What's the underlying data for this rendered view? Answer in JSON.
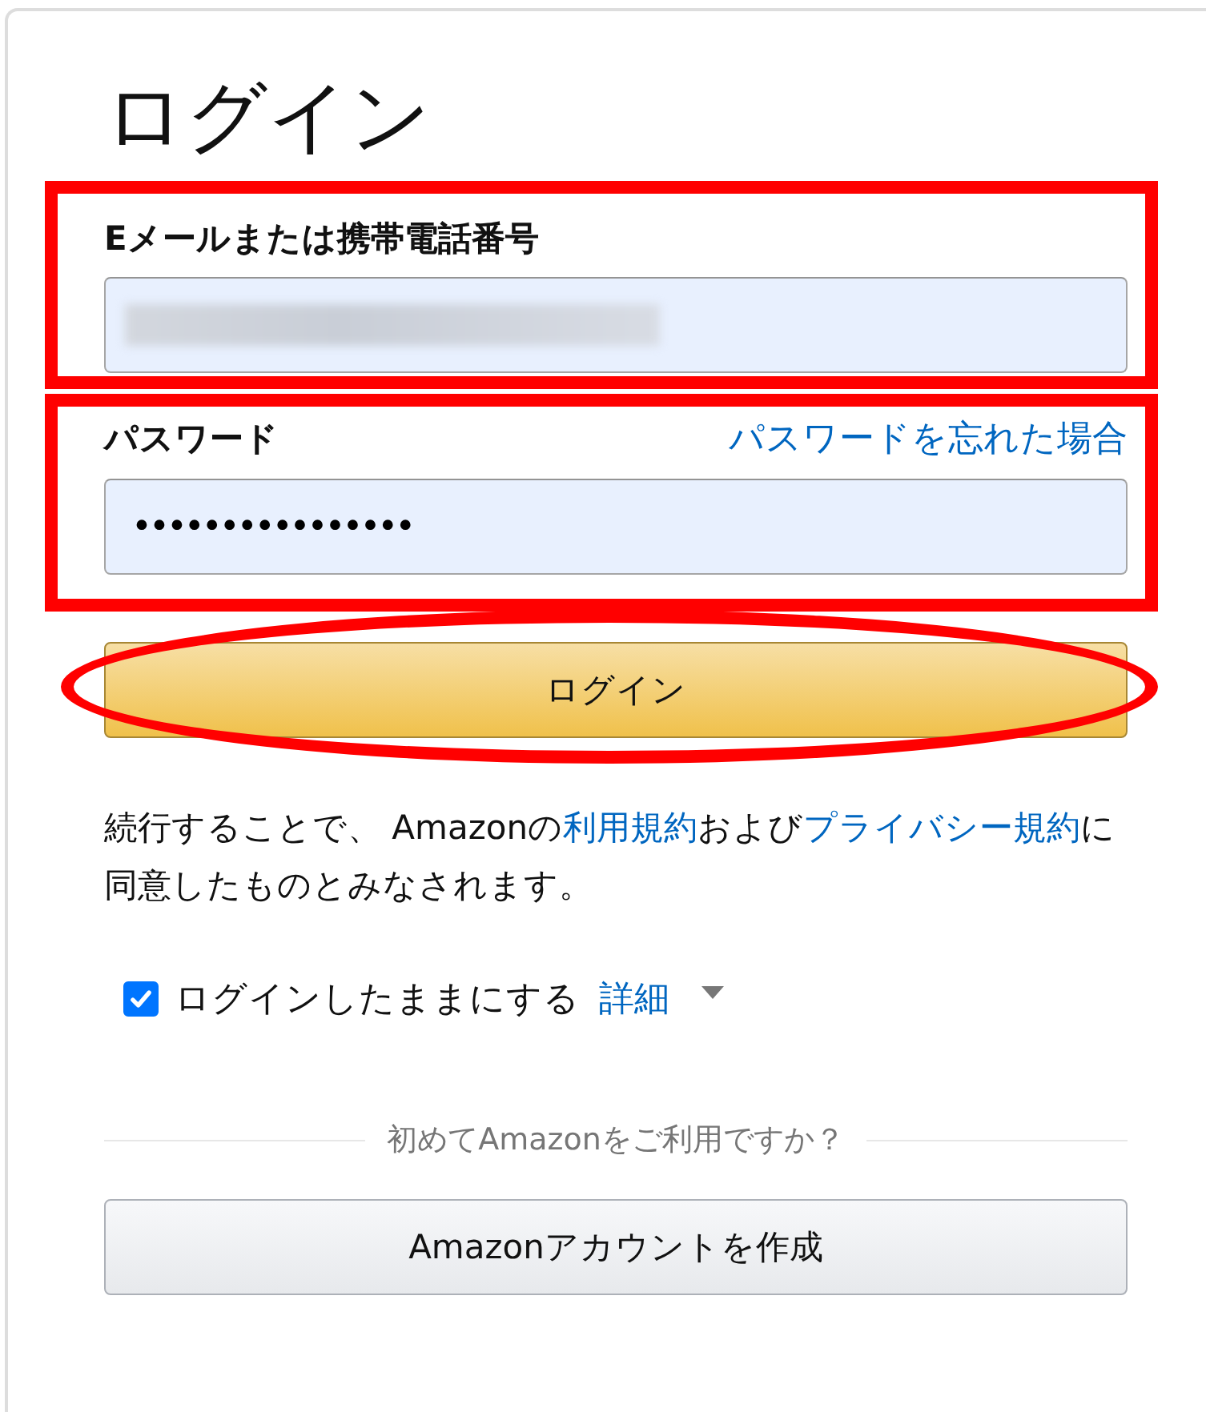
{
  "title": "ログイン",
  "email": {
    "label": "Eメールまたは携帯電話番号",
    "value_blurred": true,
    "highlighted": true
  },
  "password": {
    "label": "パスワード",
    "forgot_link": "パスワードを忘れた場合",
    "value": "••••••••••••••••",
    "highlighted": true
  },
  "login_button": {
    "label": "ログイン",
    "highlighted": true
  },
  "terms": [
    {
      "kind": "text",
      "text": "続行することで、 Amazonの"
    },
    {
      "kind": "link",
      "text": "利用規約"
    },
    {
      "kind": "text",
      "text": "および"
    },
    {
      "kind": "link",
      "text": "プライバシー規約"
    },
    {
      "kind": "text",
      "text": "に同意したものとみなされます。"
    }
  ],
  "keep_signed_in": {
    "label": "ログインしたままにする",
    "checked": true,
    "details_link": "詳細"
  },
  "divider_text": "初めてAmazonをご利用ですか？",
  "create_account_button": {
    "label": "Amazonアカウントを作成"
  }
}
